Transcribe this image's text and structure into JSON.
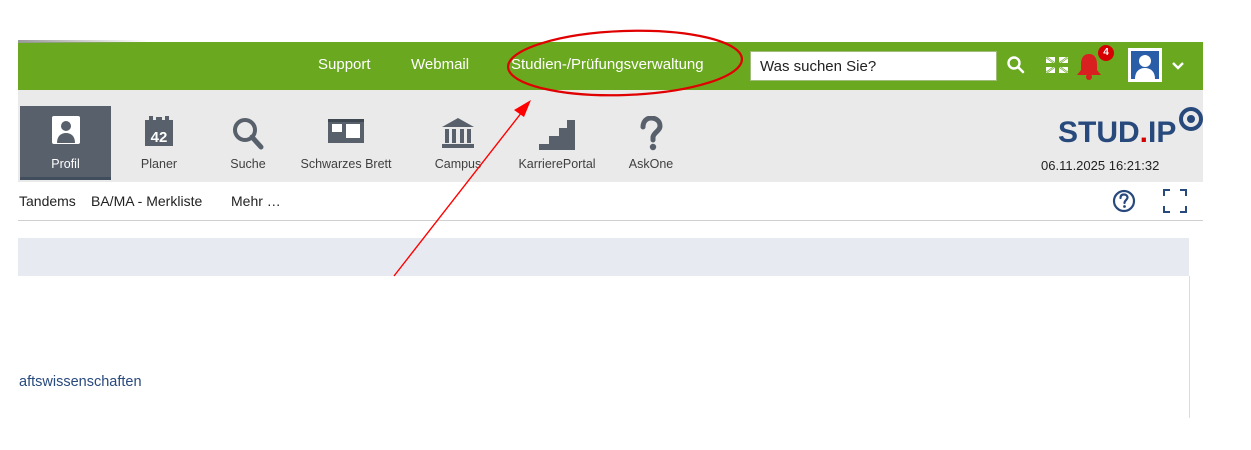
{
  "topbar": {
    "links": [
      "Support",
      "Webmail",
      "Studien-/Prüfungsverwaltung"
    ],
    "search_placeholder": "Was suchen Sie?",
    "notification_count": "4",
    "bar_color": "#6aa81f"
  },
  "navbar": {
    "items": [
      {
        "label": "Profil",
        "icon": "profile-icon"
      },
      {
        "label": "Planer",
        "icon": "calendar-icon",
        "icon_text": "42"
      },
      {
        "label": "Suche",
        "icon": "search-icon"
      },
      {
        "label": "Schwarzes Brett",
        "icon": "board-icon"
      },
      {
        "label": "Campus",
        "icon": "building-icon"
      },
      {
        "label": "KarrierePortal",
        "icon": "stairs-icon"
      },
      {
        "label": "AskOne",
        "icon": "question-icon"
      }
    ],
    "logo_main": "STUD",
    "logo_dot": ".",
    "logo_end": "IP",
    "datetime": "06.11.2025 16:21:32"
  },
  "subnav": {
    "items": [
      "Tandems",
      "BA/MA - Merkliste",
      "Mehr …"
    ]
  },
  "content": {
    "link_text": "aftswissenschaften"
  },
  "annotation": {
    "circle_color": "#e00000",
    "arrow_color": "#ff0000"
  }
}
